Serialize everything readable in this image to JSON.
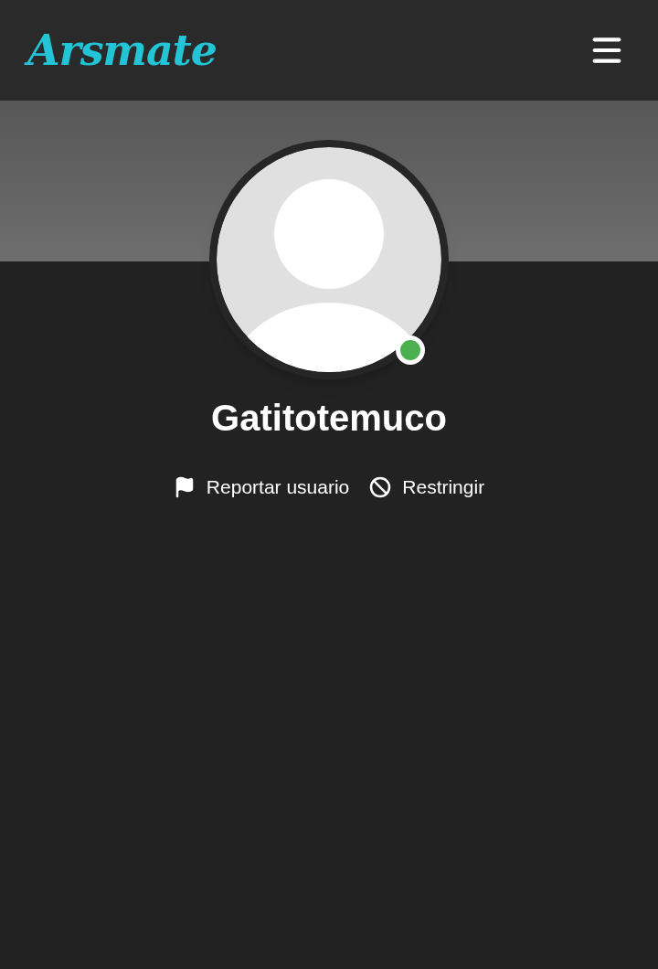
{
  "header": {
    "logo": "Arsmate"
  },
  "profile": {
    "username": "Gatitotemuco",
    "online": true
  },
  "actions": [
    {
      "kind": "report",
      "label": "Reportar usuario"
    },
    {
      "kind": "restrict",
      "label": "Restringir"
    }
  ]
}
